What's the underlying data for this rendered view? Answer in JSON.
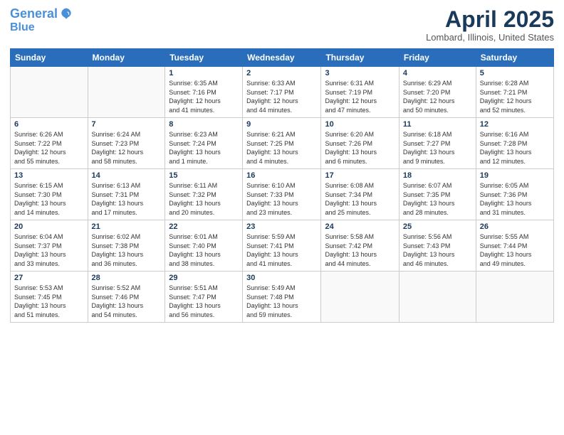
{
  "header": {
    "logo_line1": "General",
    "logo_line2": "Blue",
    "title": "April 2025",
    "location": "Lombard, Illinois, United States"
  },
  "weekdays": [
    "Sunday",
    "Monday",
    "Tuesday",
    "Wednesday",
    "Thursday",
    "Friday",
    "Saturday"
  ],
  "weeks": [
    [
      {
        "day": "",
        "info": ""
      },
      {
        "day": "",
        "info": ""
      },
      {
        "day": "1",
        "info": "Sunrise: 6:35 AM\nSunset: 7:16 PM\nDaylight: 12 hours\nand 41 minutes."
      },
      {
        "day": "2",
        "info": "Sunrise: 6:33 AM\nSunset: 7:17 PM\nDaylight: 12 hours\nand 44 minutes."
      },
      {
        "day": "3",
        "info": "Sunrise: 6:31 AM\nSunset: 7:19 PM\nDaylight: 12 hours\nand 47 minutes."
      },
      {
        "day": "4",
        "info": "Sunrise: 6:29 AM\nSunset: 7:20 PM\nDaylight: 12 hours\nand 50 minutes."
      },
      {
        "day": "5",
        "info": "Sunrise: 6:28 AM\nSunset: 7:21 PM\nDaylight: 12 hours\nand 52 minutes."
      }
    ],
    [
      {
        "day": "6",
        "info": "Sunrise: 6:26 AM\nSunset: 7:22 PM\nDaylight: 12 hours\nand 55 minutes."
      },
      {
        "day": "7",
        "info": "Sunrise: 6:24 AM\nSunset: 7:23 PM\nDaylight: 12 hours\nand 58 minutes."
      },
      {
        "day": "8",
        "info": "Sunrise: 6:23 AM\nSunset: 7:24 PM\nDaylight: 13 hours\nand 1 minute."
      },
      {
        "day": "9",
        "info": "Sunrise: 6:21 AM\nSunset: 7:25 PM\nDaylight: 13 hours\nand 4 minutes."
      },
      {
        "day": "10",
        "info": "Sunrise: 6:20 AM\nSunset: 7:26 PM\nDaylight: 13 hours\nand 6 minutes."
      },
      {
        "day": "11",
        "info": "Sunrise: 6:18 AM\nSunset: 7:27 PM\nDaylight: 13 hours\nand 9 minutes."
      },
      {
        "day": "12",
        "info": "Sunrise: 6:16 AM\nSunset: 7:28 PM\nDaylight: 13 hours\nand 12 minutes."
      }
    ],
    [
      {
        "day": "13",
        "info": "Sunrise: 6:15 AM\nSunset: 7:30 PM\nDaylight: 13 hours\nand 14 minutes."
      },
      {
        "day": "14",
        "info": "Sunrise: 6:13 AM\nSunset: 7:31 PM\nDaylight: 13 hours\nand 17 minutes."
      },
      {
        "day": "15",
        "info": "Sunrise: 6:11 AM\nSunset: 7:32 PM\nDaylight: 13 hours\nand 20 minutes."
      },
      {
        "day": "16",
        "info": "Sunrise: 6:10 AM\nSunset: 7:33 PM\nDaylight: 13 hours\nand 23 minutes."
      },
      {
        "day": "17",
        "info": "Sunrise: 6:08 AM\nSunset: 7:34 PM\nDaylight: 13 hours\nand 25 minutes."
      },
      {
        "day": "18",
        "info": "Sunrise: 6:07 AM\nSunset: 7:35 PM\nDaylight: 13 hours\nand 28 minutes."
      },
      {
        "day": "19",
        "info": "Sunrise: 6:05 AM\nSunset: 7:36 PM\nDaylight: 13 hours\nand 31 minutes."
      }
    ],
    [
      {
        "day": "20",
        "info": "Sunrise: 6:04 AM\nSunset: 7:37 PM\nDaylight: 13 hours\nand 33 minutes."
      },
      {
        "day": "21",
        "info": "Sunrise: 6:02 AM\nSunset: 7:38 PM\nDaylight: 13 hours\nand 36 minutes."
      },
      {
        "day": "22",
        "info": "Sunrise: 6:01 AM\nSunset: 7:40 PM\nDaylight: 13 hours\nand 38 minutes."
      },
      {
        "day": "23",
        "info": "Sunrise: 5:59 AM\nSunset: 7:41 PM\nDaylight: 13 hours\nand 41 minutes."
      },
      {
        "day": "24",
        "info": "Sunrise: 5:58 AM\nSunset: 7:42 PM\nDaylight: 13 hours\nand 44 minutes."
      },
      {
        "day": "25",
        "info": "Sunrise: 5:56 AM\nSunset: 7:43 PM\nDaylight: 13 hours\nand 46 minutes."
      },
      {
        "day": "26",
        "info": "Sunrise: 5:55 AM\nSunset: 7:44 PM\nDaylight: 13 hours\nand 49 minutes."
      }
    ],
    [
      {
        "day": "27",
        "info": "Sunrise: 5:53 AM\nSunset: 7:45 PM\nDaylight: 13 hours\nand 51 minutes."
      },
      {
        "day": "28",
        "info": "Sunrise: 5:52 AM\nSunset: 7:46 PM\nDaylight: 13 hours\nand 54 minutes."
      },
      {
        "day": "29",
        "info": "Sunrise: 5:51 AM\nSunset: 7:47 PM\nDaylight: 13 hours\nand 56 minutes."
      },
      {
        "day": "30",
        "info": "Sunrise: 5:49 AM\nSunset: 7:48 PM\nDaylight: 13 hours\nand 59 minutes."
      },
      {
        "day": "",
        "info": ""
      },
      {
        "day": "",
        "info": ""
      },
      {
        "day": "",
        "info": ""
      }
    ]
  ]
}
